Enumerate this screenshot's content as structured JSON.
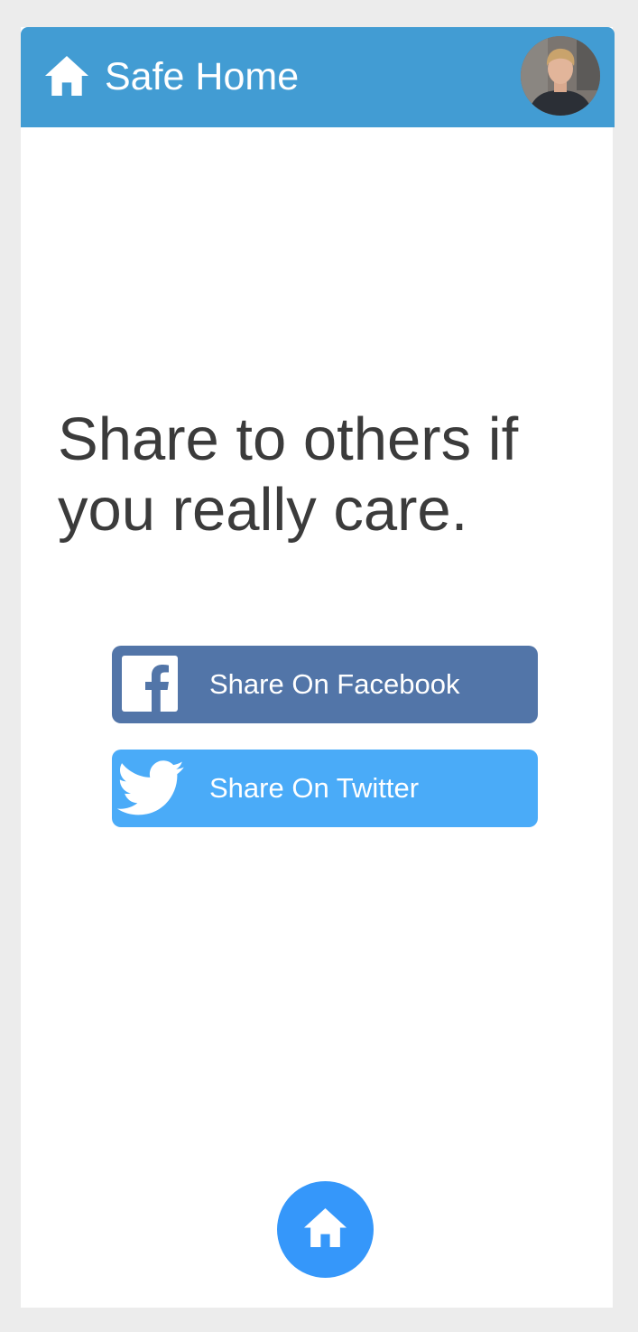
{
  "header": {
    "title": "Safe Home",
    "home_icon": "home-icon",
    "avatar_icon": "user-avatar",
    "background_color": "#429cd3"
  },
  "main": {
    "headline": "Share to others if you really care.",
    "share_buttons": [
      {
        "label": "Share On Facebook",
        "icon": "facebook-icon",
        "color": "#5275a8"
      },
      {
        "label": "Share On Twitter",
        "icon": "twitter-icon",
        "color": "#4aabf8"
      }
    ]
  },
  "bottom_nav": {
    "icon": "home-icon",
    "color": "#3597fa"
  }
}
